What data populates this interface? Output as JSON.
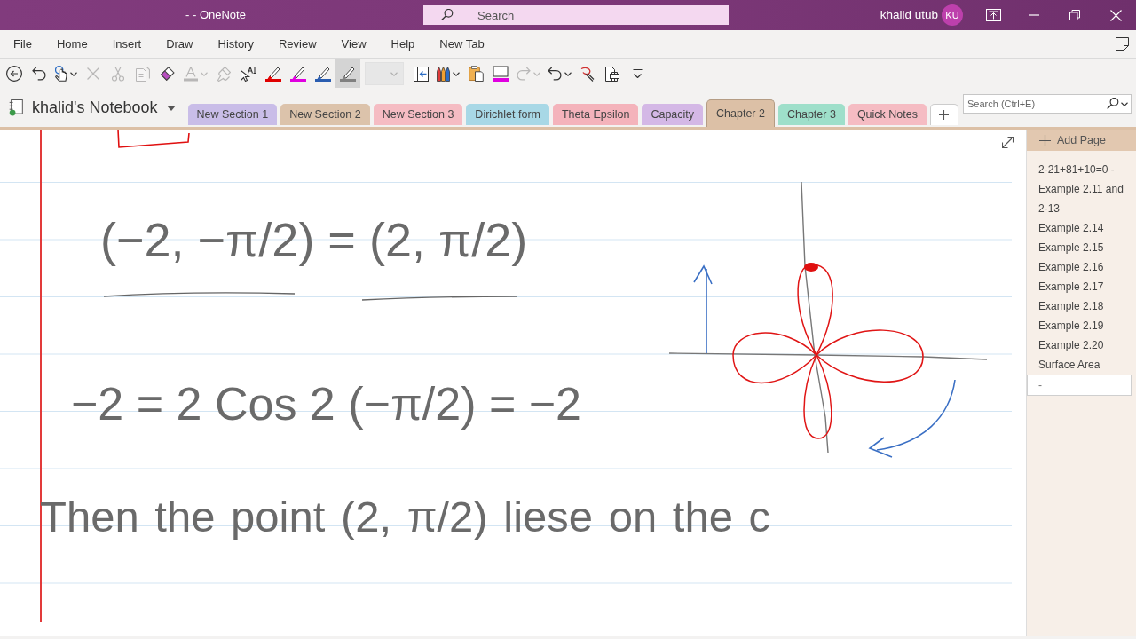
{
  "window": {
    "title": "- - OneNote"
  },
  "search": {
    "placeholder": "Search"
  },
  "account": {
    "name": "khalid utub",
    "initials": "KU"
  },
  "menu": [
    "File",
    "Home",
    "Insert",
    "Draw",
    "History",
    "Review",
    "View",
    "Help",
    "New Tab"
  ],
  "toolbar": [
    {
      "kind": "back",
      "disabled": false,
      "selected": false,
      "caret": false
    },
    {
      "kind": "undo",
      "disabled": false,
      "selected": false,
      "caret": false
    },
    {
      "kind": "touch",
      "disabled": false,
      "selected": false,
      "caret": true
    },
    {
      "kind": "delete",
      "disabled": true,
      "selected": false,
      "caret": false
    },
    {
      "kind": "cut",
      "disabled": true,
      "selected": false,
      "caret": false
    },
    {
      "kind": "copy",
      "disabled": true,
      "selected": false,
      "caret": false
    },
    {
      "kind": "eraser",
      "disabled": false,
      "selected": false,
      "caret": false
    },
    {
      "kind": "font_color",
      "disabled": true,
      "selected": false,
      "caret": true
    },
    {
      "kind": "format_painter",
      "disabled": true,
      "selected": false,
      "caret": false
    },
    {
      "kind": "ink_to_text",
      "disabled": false,
      "selected": false,
      "caret": false
    },
    {
      "kind": "pen",
      "color": "#e00000",
      "disabled": false,
      "selected": false,
      "caret": false
    },
    {
      "kind": "pen",
      "color": "#e000e0",
      "disabled": false,
      "selected": false,
      "caret": false
    },
    {
      "kind": "pen",
      "color": "#2a5db0",
      "disabled": false,
      "selected": false,
      "caret": false
    },
    {
      "kind": "pen",
      "color": "#808080",
      "disabled": false,
      "selected": true,
      "caret": false
    },
    {
      "kind": "combo",
      "disabled": true,
      "selected": false,
      "caret": false
    },
    {
      "kind": "insert_space",
      "disabled": false,
      "selected": false,
      "caret": false
    },
    {
      "kind": "pens",
      "disabled": false,
      "selected": false,
      "caret": true
    },
    {
      "kind": "paste",
      "disabled": false,
      "selected": false,
      "caret": false
    },
    {
      "kind": "highlight",
      "color": "#e000e0",
      "disabled": false,
      "selected": false,
      "caret": false
    },
    {
      "kind": "redo",
      "disabled": true,
      "selected": false,
      "caret": true
    },
    {
      "kind": "undo",
      "disabled": false,
      "selected": false,
      "caret": true
    },
    {
      "kind": "lasso",
      "disabled": false,
      "selected": false,
      "caret": false
    },
    {
      "kind": "print",
      "disabled": false,
      "selected": false,
      "caret": false
    },
    {
      "kind": "customize",
      "disabled": false,
      "selected": false,
      "caret": false
    }
  ],
  "notebook": {
    "name": "khalid's Notebook"
  },
  "sections": [
    {
      "label": "New Section 1",
      "color": "#c9bde8",
      "selected": false
    },
    {
      "label": "New Section 2",
      "color": "#dcc3ab",
      "selected": false
    },
    {
      "label": "New Section 3",
      "color": "#f5bcc3",
      "selected": false
    },
    {
      "label": "Dirichlet form",
      "color": "#a8d8e6",
      "selected": false
    },
    {
      "label": "Theta Epsilon",
      "color": "#f4b3bb",
      "selected": false
    },
    {
      "label": "Capacity",
      "color": "#d4b8e6",
      "selected": false
    },
    {
      "label": "Chapter 2",
      "color": "#dcc0a6",
      "selected": true
    },
    {
      "label": "Chapter 3",
      "color": "#9edfca",
      "selected": false
    },
    {
      "label": "Quick Notes",
      "color": "#f5bcc3",
      "selected": false
    }
  ],
  "section_search": {
    "placeholder": "Search (Ctrl+E)"
  },
  "pages": {
    "add_label": "Add Page",
    "items": [
      {
        "title": "2-21+81+10=0 -",
        "selected": false
      },
      {
        "title": "Example 2.11 and 2-13",
        "selected": false
      },
      {
        "title": "Example 2.14",
        "selected": false
      },
      {
        "title": "Example 2.15",
        "selected": false
      },
      {
        "title": "Example 2.16",
        "selected": false
      },
      {
        "title": "Example 2.17",
        "selected": false
      },
      {
        "title": "Example 2.18",
        "selected": false
      },
      {
        "title": "Example 2.19",
        "selected": false
      },
      {
        "title": "Example 2.20",
        "selected": false
      },
      {
        "title": "Surface Area",
        "selected": false
      },
      {
        "title": "-",
        "selected": true
      }
    ]
  },
  "page_ink": {
    "lines": [
      "(−2, −π/2) = (2, π/2)",
      "−2 = 2 Cos 2 (−π/2) = −2",
      "Then the point (2, π/2) liese on the c"
    ]
  }
}
